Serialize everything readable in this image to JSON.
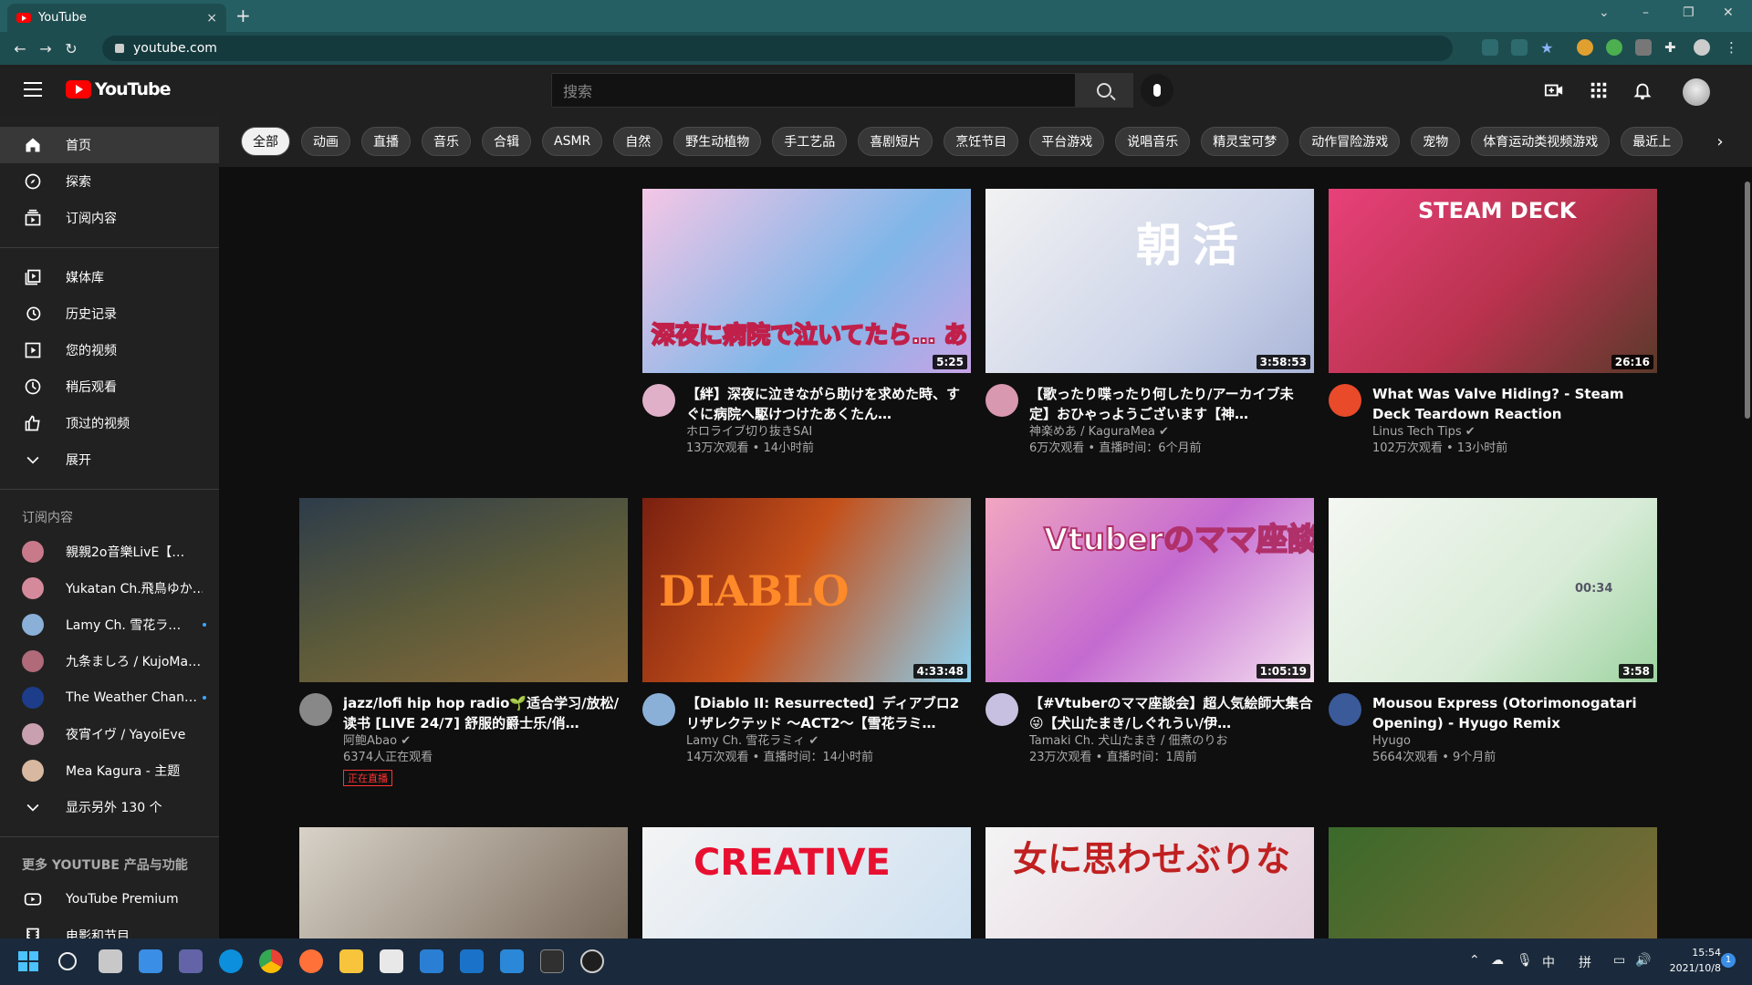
{
  "browser": {
    "tab_title": "YouTube",
    "tab_close": "×",
    "new_tab": "+",
    "url": "youtube.com",
    "back": "←",
    "forward": "→",
    "reload": "↻"
  },
  "masthead": {
    "logo_text": "YouTube",
    "search_placeholder": "搜索"
  },
  "sidebar": {
    "primary": [
      {
        "label": "首页",
        "icon": "home-icon"
      },
      {
        "label": "探索",
        "icon": "compass-icon"
      },
      {
        "label": "订阅内容",
        "icon": "subscriptions-icon"
      }
    ],
    "library": [
      {
        "label": "媒体库",
        "icon": "library-icon"
      },
      {
        "label": "历史记录",
        "icon": "history-icon"
      },
      {
        "label": "您的视频",
        "icon": "your-videos-icon"
      },
      {
        "label": "稍后观看",
        "icon": "watch-later-icon"
      },
      {
        "label": "顶过的视频",
        "icon": "thumbs-up-icon"
      },
      {
        "label": "展开",
        "icon": "chevron-down-icon"
      }
    ],
    "subs_header": "订阅内容",
    "subscriptions": [
      {
        "label": "親親2o音樂LivE【…",
        "color": "#c97a8a"
      },
      {
        "label": "Yukatan Ch.飛鳥ゆか…",
        "color": "#d48a9a"
      },
      {
        "label": "Lamy Ch. 雪花ラ…",
        "color": "#8ab0d8"
      },
      {
        "label": "九条ましろ / KujoMa…",
        "color": "#b06a7a"
      },
      {
        "label": "The Weather Chan…",
        "color": "#1d3d8a"
      },
      {
        "label": "夜宵イヴ / YayoiEve",
        "color": "#c8a0b0"
      },
      {
        "label": "Mea Kagura - 主题",
        "color": "#d8b8a0"
      }
    ],
    "show_more": "显示另外 130 个",
    "more_header": "更多 YOUTUBE 产品与功能",
    "more": [
      {
        "label": "YouTube Premium",
        "icon": "youtube-premium-icon"
      },
      {
        "label": "电影和节目",
        "icon": "film-icon"
      }
    ]
  },
  "chips": [
    "全部",
    "动画",
    "直播",
    "音乐",
    "合辑",
    "ASMR",
    "自然",
    "野生动植物",
    "手工艺品",
    "喜剧短片",
    "烹饪节目",
    "平台游戏",
    "说唱音乐",
    "精灵宝可梦",
    "动作冒险游戏",
    "宠物",
    "体育运动类视频游戏",
    "最近上"
  ],
  "chip_next": "›",
  "videos": [
    {
      "title": "【絆】深夜に泣きながら助けを求めた時、すぐに病院へ駆けつけたあくたん…",
      "channel": "ホロライブ切り抜きSAI",
      "stats": "13万次观看 • 14小时前",
      "duration": "5:25",
      "thumb_text": "深夜に病院で泣いてたら… あくあちゃんが来てくれた"
    },
    {
      "title": "【歌ったり喋ったり何したり/アーカイブ未定】おひゃっようございます【神…",
      "channel": "神楽めあ / KaguraMea ✔",
      "stats": "6万次观看 • 直播时间：6个月前",
      "duration": "3:58:53",
      "thumb_text": "朝活"
    },
    {
      "title": "What Was Valve Hiding? - Steam Deck Teardown Reaction",
      "channel": "Linus Tech Tips ✔",
      "stats": "102万次观看 • 13小时前",
      "duration": "26:16",
      "thumb_text": "STEAM DECK"
    },
    {
      "title": "jazz/lofi hip hop radio🌱适合学习/放松/读书 [LIVE 24/7] 舒服的爵士乐/俏…",
      "channel": "阿鲍Abao ✔",
      "stats": "6374人正在观看",
      "badge": "正在直播",
      "thumb_text": ""
    },
    {
      "title": "【Diablo II: Resurrected】ディアブロ2 リザレクテッド ～ACT2～【雪花ラミ…",
      "channel": "Lamy Ch. 雪花ラミィ ✔",
      "stats": "14万次观看 • 直播时间：14小时前",
      "duration": "4:33:48",
      "thumb_text": "DIABLO"
    },
    {
      "title": "【#Vtuberのママ座談会】超人気絵師大集合😜【犬山たまき/しぐれうい/伊…",
      "channel": "Tamaki Ch. 犬山たまき / 佃煮のりお",
      "stats": "23万次观看 • 直播时间：1周前",
      "duration": "1:05:19",
      "thumb_text": "Vtuberのママ座談会"
    },
    {
      "title": "Mousou Express (Otorimonogatari Opening) - Hyugo Remix",
      "channel": "Hyugo",
      "stats": "5664次观看 • 9个月前",
      "duration": "3:58",
      "thumb_text": "00:34"
    },
    {
      "title": "",
      "channel": "",
      "stats": "",
      "thumb_text": ""
    },
    {
      "title": "",
      "channel": "",
      "stats": "",
      "thumb_text": "CREATIVE"
    },
    {
      "title": "",
      "channel": "",
      "stats": "",
      "thumb_text": "女に思わせぶりな"
    },
    {
      "title": "",
      "channel": "",
      "stats": "",
      "thumb_text": ""
    }
  ],
  "taskbar": {
    "time": "15:54",
    "date": "2021/10/8",
    "ime1": "中",
    "ime2": "拼",
    "notif_count": "1"
  }
}
